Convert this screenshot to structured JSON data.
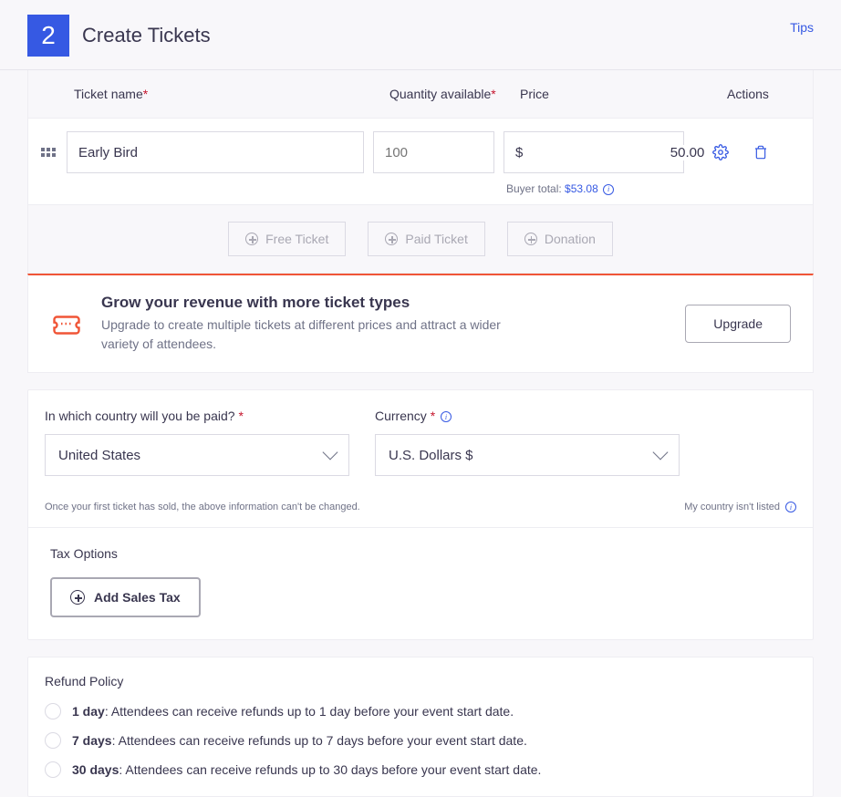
{
  "step": {
    "number": "2",
    "title": "Create Tickets",
    "tips_label": "Tips"
  },
  "columns": {
    "name": "Ticket name",
    "quantity": "Quantity available",
    "price": "Price",
    "actions": "Actions"
  },
  "ticket": {
    "name": "Early Bird",
    "quantity_placeholder": "100",
    "currency_symbol": "$",
    "price": "50.00",
    "buyer_total_label": "Buyer total:",
    "buyer_total_amount": "$53.08"
  },
  "add_buttons": {
    "free": "Free Ticket",
    "paid": "Paid Ticket",
    "donation": "Donation"
  },
  "upsell": {
    "title": "Grow your revenue with more ticket types",
    "subtitle": "Upgrade to create multiple tickets at different prices and attract a wider variety of attendees.",
    "button": "Upgrade"
  },
  "payment": {
    "country_label": "In which country will you be paid?",
    "country_value": "United States",
    "currency_label": "Currency",
    "currency_value": "U.S. Dollars $",
    "lock_note": "Once your first ticket has sold, the above information can't be changed.",
    "not_listed": "My country isn't listed"
  },
  "tax": {
    "title": "Tax Options",
    "button": "Add Sales Tax"
  },
  "refund": {
    "title": "Refund Policy",
    "options": [
      {
        "bold": "1 day",
        "rest": ": Attendees can receive refunds up to 1 day before your event start date."
      },
      {
        "bold": "7 days",
        "rest": ": Attendees can receive refunds up to 7 days before your event start date."
      },
      {
        "bold": "30 days",
        "rest": ": Attendees can receive refunds up to 30 days before your event start date."
      }
    ]
  }
}
